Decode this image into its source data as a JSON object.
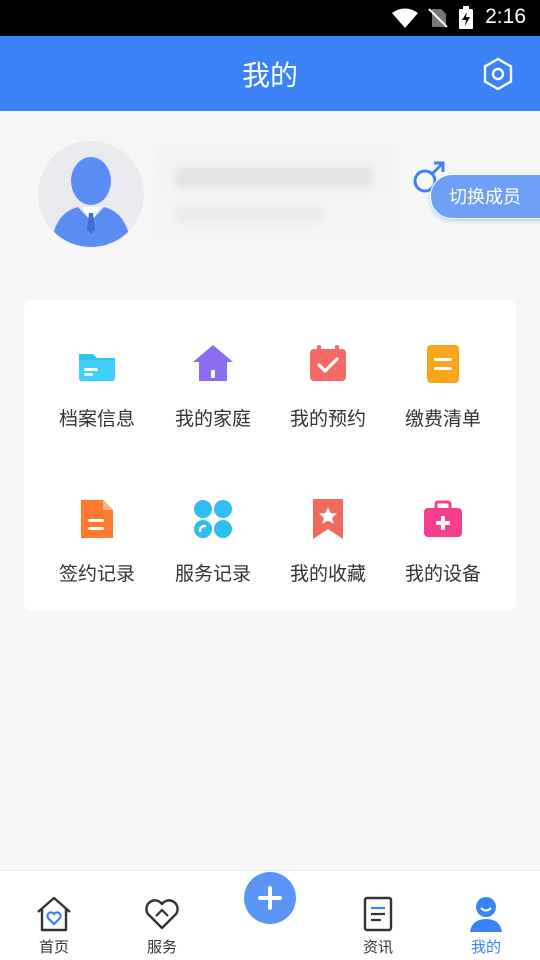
{
  "status_bar": {
    "time": "2:16"
  },
  "header": {
    "title": "我的"
  },
  "profile": {
    "switch_member_label": "切换成员"
  },
  "grid": {
    "items": [
      {
        "label": "档案信息",
        "icon": "folder-icon"
      },
      {
        "label": "我的家庭",
        "icon": "house-icon"
      },
      {
        "label": "我的预约",
        "icon": "calendar-check-icon"
      },
      {
        "label": "缴费清单",
        "icon": "bill-icon"
      },
      {
        "label": "签约记录",
        "icon": "document-icon"
      },
      {
        "label": "服务记录",
        "icon": "clover-icon"
      },
      {
        "label": "我的收藏",
        "icon": "bookmark-star-icon"
      },
      {
        "label": "我的设备",
        "icon": "medical-kit-icon"
      }
    ]
  },
  "tabbar": {
    "items": [
      {
        "label": "首页",
        "icon": "home-heart-icon"
      },
      {
        "label": "服务",
        "icon": "handshake-heart-icon"
      },
      {
        "label": "资讯",
        "icon": "news-doc-icon"
      },
      {
        "label": "我的",
        "icon": "user-icon",
        "active": true
      }
    ]
  },
  "colors": {
    "primary": "#3b82f8",
    "background": "#f6f6f6"
  }
}
